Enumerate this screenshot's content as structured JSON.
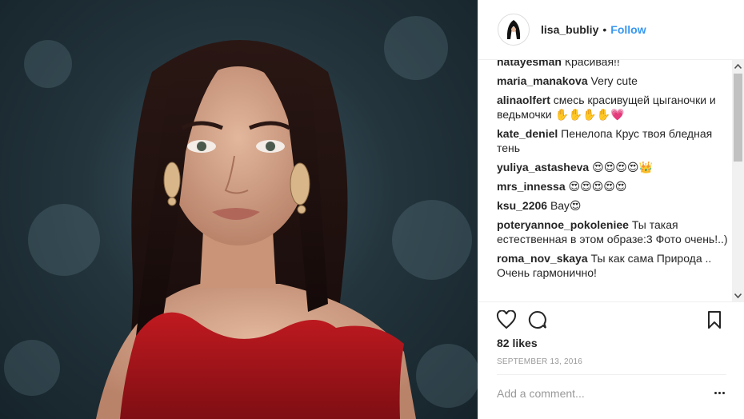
{
  "post": {
    "username": "lisa_bubliy",
    "separator": "•",
    "follow_label": "Follow",
    "likes": "82 likes",
    "date": "SEPTEMBER 13, 2016",
    "comment_placeholder": "Add a comment..."
  },
  "comments": [
    {
      "user": "natayesman",
      "text": "Красивая!!"
    },
    {
      "user": "maria_manakova",
      "text": "Very cute"
    },
    {
      "user": "alinaolfert",
      "text": "смесь красивущей цыганочки и ведьмочки ✋✋✋✋💗"
    },
    {
      "user": "kate_deniel",
      "text": "Пенелопа Крус твоя бледная тень"
    },
    {
      "user": "yuliya_astasheva",
      "text": "😍😍😍😍👑"
    },
    {
      "user": "mrs_innessa",
      "text": "😍😍😍😍😍"
    },
    {
      "user": "ksu_2206",
      "text": "Вау😍"
    },
    {
      "user": "poteryannoe_pokoleniee",
      "text": "Ты такая естественная в этом образе:3 Фото очень!..)"
    },
    {
      "user": "roma_nov_skaya",
      "text": "Ты как сама Природа .. Очень гармонично!"
    }
  ],
  "icons": [
    "heart-icon",
    "comment-icon",
    "bookmark-icon",
    "more-icon",
    "scroll-up-icon",
    "scroll-down-icon"
  ],
  "colors": {
    "follow": "#3897f0",
    "text": "#262626",
    "muted": "#999999",
    "dress": "#b0161c"
  }
}
